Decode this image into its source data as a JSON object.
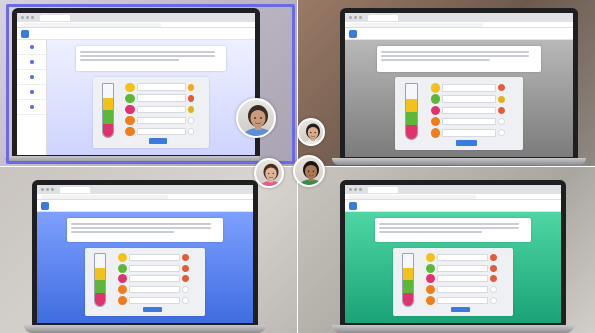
{
  "laptops": [
    {
      "id": "top-left",
      "bg_gradient": [
        "#eef0ff",
        "#cfd4ff"
      ],
      "has_sidebar": true,
      "active_border": "#6a6ae8",
      "options": [
        {
          "color": "#f2c21b",
          "flag": "#f2a81b"
        },
        {
          "color": "#5db83a",
          "flag": "#e35c3a"
        },
        {
          "color": "#e0336e",
          "flag": "#e0b21b"
        },
        {
          "color": "#ef7d1b",
          "flag": ""
        },
        {
          "color": "#ef7d1b",
          "flag": ""
        }
      ]
    },
    {
      "id": "top-right",
      "bg_gradient": [
        "#b8b8b8",
        "#7c7c7c"
      ],
      "has_sidebar": false,
      "options": [
        {
          "color": "#f2c21b",
          "flag": "#e35c3a"
        },
        {
          "color": "#5db83a",
          "flag": "#e0b21b"
        },
        {
          "color": "#e0336e",
          "flag": "#e35c3a"
        },
        {
          "color": "#ef7d1b",
          "flag": ""
        },
        {
          "color": "#ef7d1b",
          "flag": ""
        }
      ]
    },
    {
      "id": "bottom-left",
      "bg_gradient": [
        "#7ea0ff",
        "#3f6de0"
      ],
      "has_sidebar": false,
      "options": [
        {
          "color": "#f2c21b",
          "flag": "#e35c3a"
        },
        {
          "color": "#5db83a",
          "flag": "#e35c3a"
        },
        {
          "color": "#e0336e",
          "flag": "#e35c3a"
        },
        {
          "color": "#ef7d1b",
          "flag": ""
        },
        {
          "color": "#ef7d1b",
          "flag": ""
        }
      ]
    },
    {
      "id": "bottom-right",
      "bg_gradient": [
        "#4fd6a4",
        "#1aa377"
      ],
      "has_sidebar": false,
      "options": [
        {
          "color": "#f2c21b",
          "flag": "#e35c3a"
        },
        {
          "color": "#5db83a",
          "flag": "#e35c3a"
        },
        {
          "color": "#e0336e",
          "flag": "#e35c3a"
        },
        {
          "color": "#ef7d1b",
          "flag": ""
        },
        {
          "color": "#ef7d1b",
          "flag": ""
        }
      ]
    }
  ],
  "webcams": [
    {
      "id": "webcam-woman",
      "skin": "#c99a7c",
      "hair": "#3a2a22",
      "shirt": "#5b8fd6"
    },
    {
      "id": "webcam-boy-1",
      "skin": "#d8ad8c",
      "hair": "#2a1e18",
      "shirt": "#e8e8e8"
    },
    {
      "id": "webcam-girl",
      "skin": "#e0b59a",
      "hair": "#4a2e1e",
      "shirt": "#e05c8a"
    },
    {
      "id": "webcam-boy-2",
      "skin": "#a97a5a",
      "hair": "#1e1410",
      "shirt": "#3a8a4a"
    }
  ],
  "tube_layers": [
    {
      "color": "#f2c21b",
      "fraction": 0.22
    },
    {
      "color": "#5db83a",
      "fraction": 0.24
    },
    {
      "color": "#e0336e",
      "fraction": 0.24
    }
  ]
}
